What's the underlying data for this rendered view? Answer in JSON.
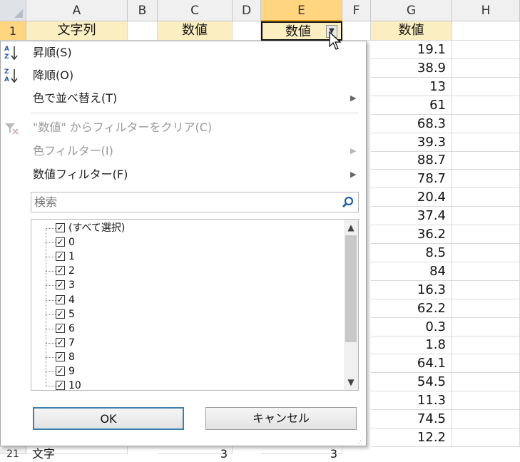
{
  "columns": [
    "A",
    "B",
    "C",
    "D",
    "E",
    "F",
    "G",
    "H"
  ],
  "rows": {
    "first": "1",
    "last": "21"
  },
  "header_row": {
    "a": "文字列",
    "c": "数値",
    "e": "数値",
    "g": "数値"
  },
  "col_g_values": [
    "19.1",
    "38.9",
    "13",
    "61",
    "68.3",
    "39.3",
    "88.7",
    "78.7",
    "20.4",
    "37.4",
    "36.2",
    "8.5",
    "84",
    "16.3",
    "62.2",
    "0.3",
    "1.8",
    "64.1",
    "54.5",
    "11.3",
    "74.5",
    "12.2"
  ],
  "partial_bottom_row": {
    "a": "文字",
    "c": "3",
    "e": "3"
  },
  "menu": {
    "sort_asc": "昇順(S)",
    "sort_desc": "降順(O)",
    "sort_by_color": "色で並べ替え(T)",
    "clear_filter": "\"数値\" からフィルターをクリア(C)",
    "color_filter": "色フィルター(I)",
    "number_filter": "数値フィルター(F)"
  },
  "search": {
    "placeholder": "検索"
  },
  "filter_list": [
    {
      "label": "(すべて選択)",
      "checked": true
    },
    {
      "label": "0",
      "checked": true
    },
    {
      "label": "1",
      "checked": true
    },
    {
      "label": "2",
      "checked": true
    },
    {
      "label": "3",
      "checked": true
    },
    {
      "label": "4",
      "checked": true
    },
    {
      "label": "5",
      "checked": true
    },
    {
      "label": "6",
      "checked": true
    },
    {
      "label": "7",
      "checked": true
    },
    {
      "label": "8",
      "checked": true
    },
    {
      "label": "9",
      "checked": true
    },
    {
      "label": "10",
      "checked": true
    }
  ],
  "buttons": {
    "ok": "OK",
    "cancel": "キャンセル"
  },
  "colors": {
    "header_fill": "#fbefc1",
    "selected_col": "#ffd580",
    "ok_border": "#3c7fb1"
  }
}
